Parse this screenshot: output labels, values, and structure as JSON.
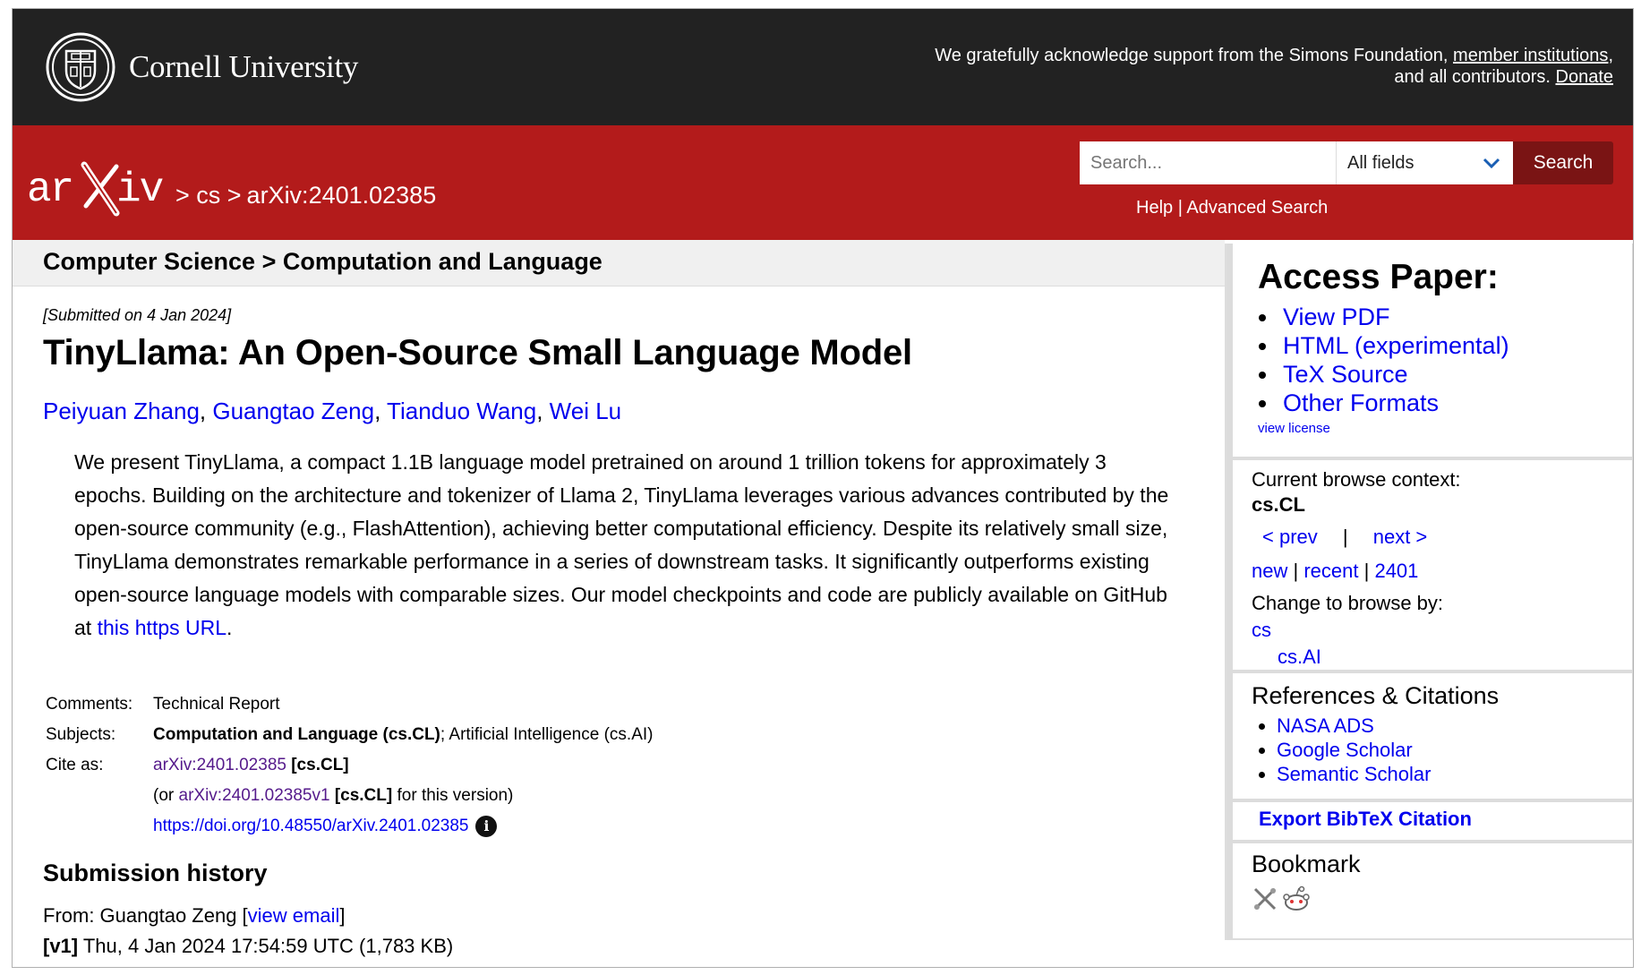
{
  "cornell": {
    "name": "Cornell University",
    "ack_text": "We gratefully acknowledge support from the Simons Foundation,",
    "ack_link1": "member institutions",
    "ack_mid": ", and all contributors.",
    "ack_link2": "Donate"
  },
  "header": {
    "logo": "arXiv",
    "crumb1": "> cs >",
    "crumb2": "arXiv:2401.02385",
    "search_placeholder": "Search...",
    "field_select": "All fields",
    "search_button": "Search",
    "help": "Help",
    "sep": "|",
    "advanced": "Advanced Search"
  },
  "subject_bar": "Computer Science > Computation and Language",
  "paper": {
    "dateline": "[Submitted on 4 Jan 2024]",
    "title": "TinyLlama: An Open-Source Small Language Model",
    "authors": [
      "Peiyuan Zhang",
      "Guangtao Zeng",
      "Tianduo Wang",
      "Wei Lu"
    ],
    "abstract": "We present TinyLlama, a compact 1.1B language model pretrained on around 1 trillion tokens for approximately 3 epochs. Building on the architecture and tokenizer of Llama 2, TinyLlama leverages various advances contributed by the open-source community (e.g., FlashAttention), achieving better computational efficiency. Despite its relatively small size, TinyLlama demonstrates remarkable performance in a series of downstream tasks. It significantly outperforms existing open-source language models with comparable sizes. Our model checkpoints and code are publicly available on GitHub at",
    "abstract_link": "this https URL",
    "abstract_end": "."
  },
  "meta": {
    "comments_label": "Comments:",
    "comments": "Technical Report",
    "subjects_label": "Subjects:",
    "subject_primary": "Computation and Language (cs.CL)",
    "subject_rest": "; Artificial Intelligence (cs.AI)",
    "cite_label": "Cite as:",
    "cite_id": "arXiv:2401.02385",
    "cite_tag": "[cs.CL]",
    "cite2_pre": "(or",
    "cite2_id": "arXiv:2401.02385v1",
    "cite2_tag": "[cs.CL]",
    "cite2_post": "for this version)",
    "doi": "https://doi.org/10.48550/arXiv.2401.02385",
    "info_glyph": "i"
  },
  "history": {
    "title": "Submission history",
    "from_pre": "From: Guangtao Zeng [",
    "from_link": "view email",
    "from_post": "]",
    "v1_tag": "[v1]",
    "v1_text": "Thu, 4 Jan 2024 17:54:59 UTC (1,783 KB)"
  },
  "sidebar": {
    "access_title": "Access Paper:",
    "access_links": [
      "View PDF",
      "HTML (experimental)",
      "TeX Source",
      "Other Formats"
    ],
    "view_license": "view license",
    "context_label": "Current browse context:",
    "context_value": "cs.CL",
    "prev": "< prev",
    "nav_sep": "|",
    "next": "next >",
    "new": "new",
    "recent": "recent",
    "month": "2401",
    "change_label": "Change to browse by:",
    "browse1": "cs",
    "browse2": "cs.AI",
    "refs_title": "References & Citations",
    "refs": [
      "NASA ADS",
      "Google Scholar",
      "Semantic Scholar"
    ],
    "bibtex": "Export BibTeX Citation",
    "bookmark_title": "Bookmark"
  }
}
